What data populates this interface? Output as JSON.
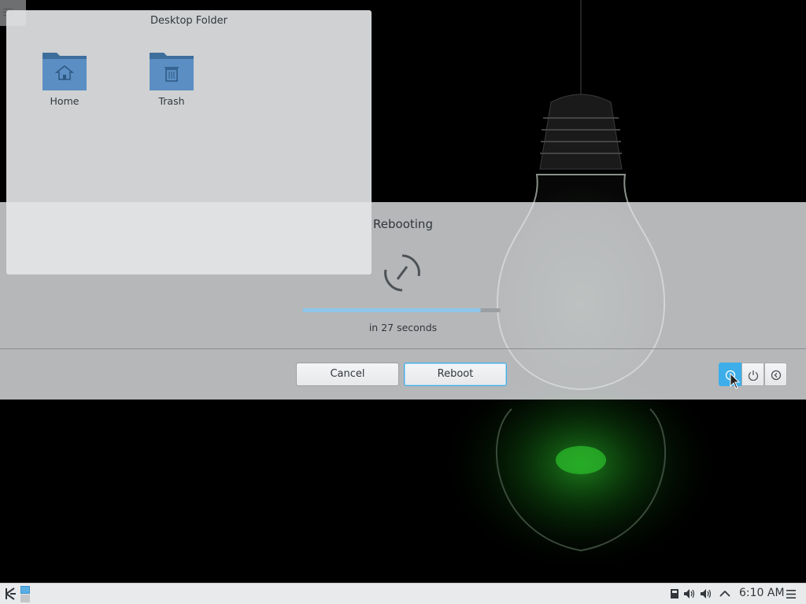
{
  "desktop": {
    "folder_title": "Desktop Folder",
    "items": [
      {
        "label": "Home",
        "icon": "folder-home-icon"
      },
      {
        "label": "Trash",
        "icon": "trash-folder-icon"
      }
    ]
  },
  "logout_dialog": {
    "title": "Rebooting",
    "icon": "reboot-icon",
    "progress": 0.9,
    "countdown": "in 27 seconds",
    "cancel_label": "Cancel",
    "confirm_label": "Reboot",
    "actions": [
      {
        "name": "reboot",
        "icon": "reboot-icon",
        "selected": true
      },
      {
        "name": "shutdown",
        "icon": "power-icon",
        "selected": false
      },
      {
        "name": "logout",
        "icon": "logout-icon",
        "selected": false
      }
    ]
  },
  "taskbar": {
    "clock": "6:10 AM",
    "tray_icons": [
      "device-notifier-icon",
      "volume-icon",
      "volume-icon",
      "chevron-up-icon",
      "menu-icon"
    ]
  },
  "colors": {
    "accent": "#3daee9",
    "text": "#31363b",
    "progress_fill": "#8ec6ea"
  }
}
